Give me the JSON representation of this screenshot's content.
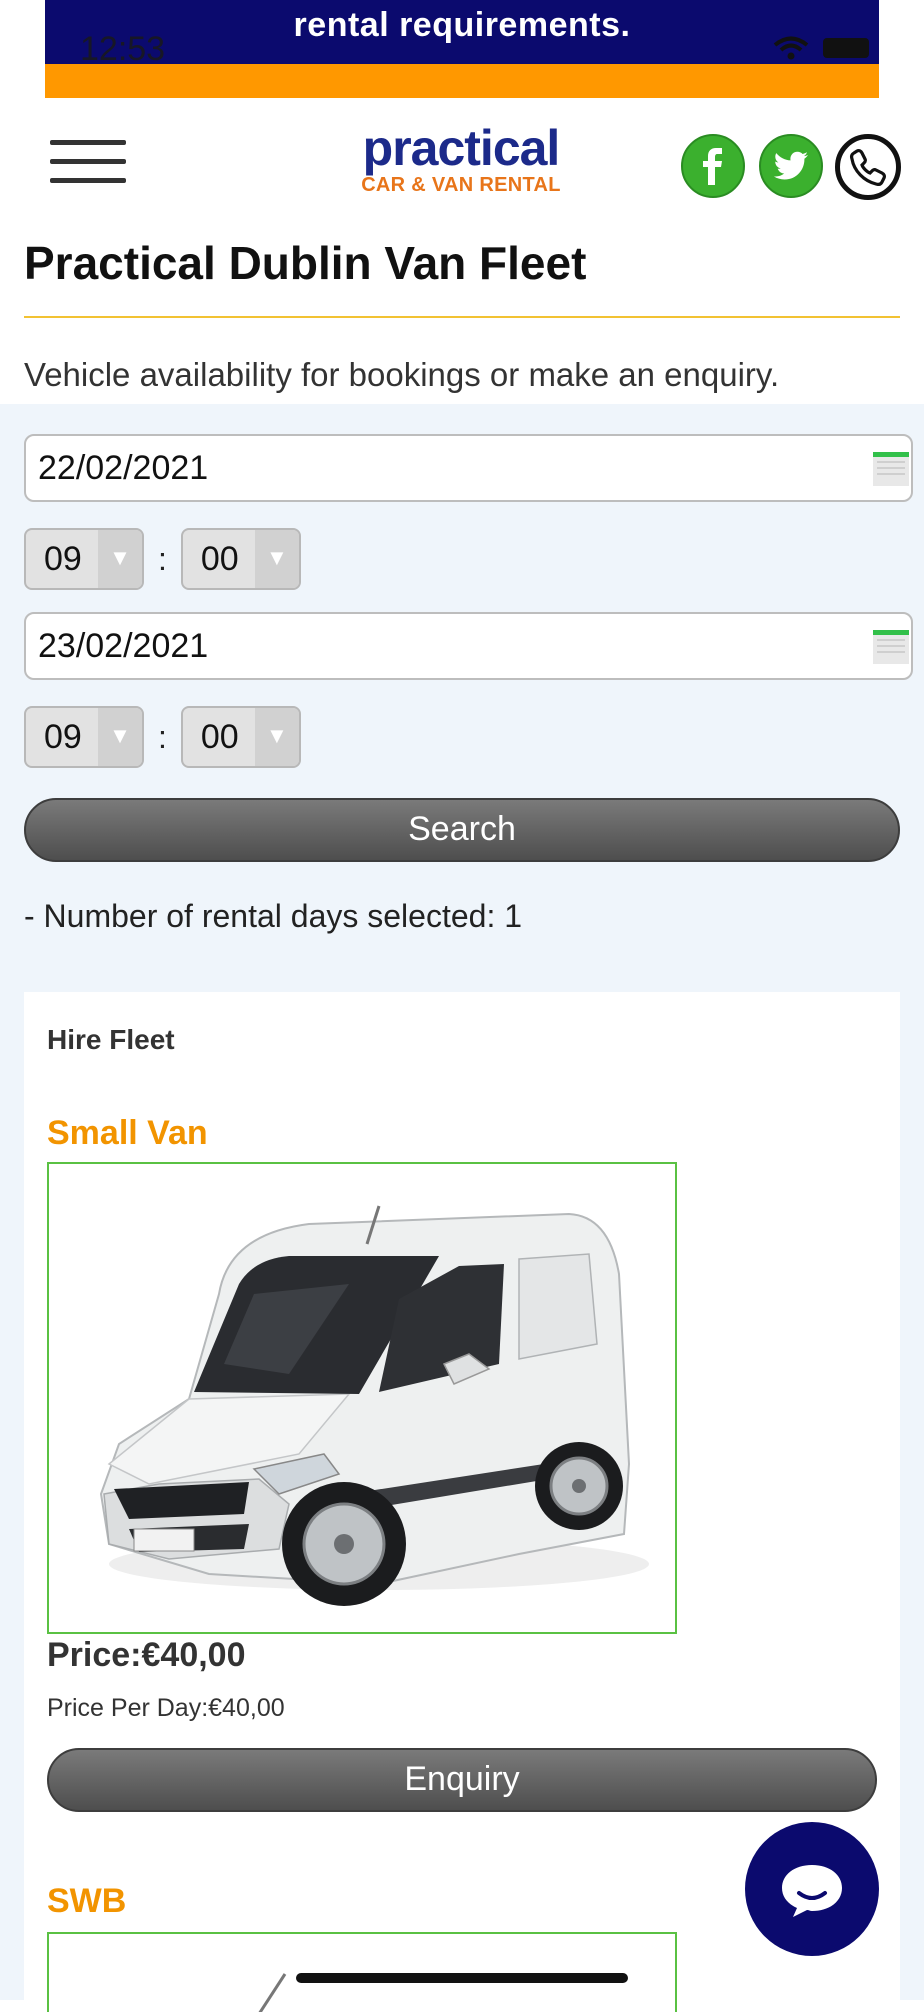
{
  "status_bar": {
    "time": "12:53"
  },
  "banner": {
    "text": "rental requirements.",
    "bg_color": "#0b0a6e",
    "stripe_color": "#ff9800"
  },
  "header": {
    "logo": {
      "main": "practical",
      "sub": "CAR & VAN RENTAL"
    },
    "social_icons": [
      "facebook-icon",
      "twitter-icon",
      "phone-icon"
    ]
  },
  "page": {
    "title": "Practical Dublin Van Fleet",
    "intro": "Vehicle availability for bookings or make an enquiry."
  },
  "booking_form": {
    "pickup_date": "22/02/2021",
    "pickup_hour": "09",
    "pickup_minute": "00",
    "return_date": "23/02/2021",
    "return_hour": "09",
    "return_minute": "00",
    "time_separator": ":",
    "search_label": "Search",
    "rental_days_text": "- Number of rental days selected: 1"
  },
  "fleet": {
    "heading": "Hire Fleet",
    "vehicles": [
      {
        "name": "Small Van",
        "price": "Price:€40,00",
        "price_per_day": "Price Per Day:€40,00",
        "enquiry_label": "Enquiry"
      },
      {
        "name": "SWB"
      }
    ]
  },
  "colors": {
    "accent_orange": "#f29400",
    "brand_blue": "#1c2a8a",
    "social_green": "#3bb02e",
    "image_border": "#5ac143"
  }
}
